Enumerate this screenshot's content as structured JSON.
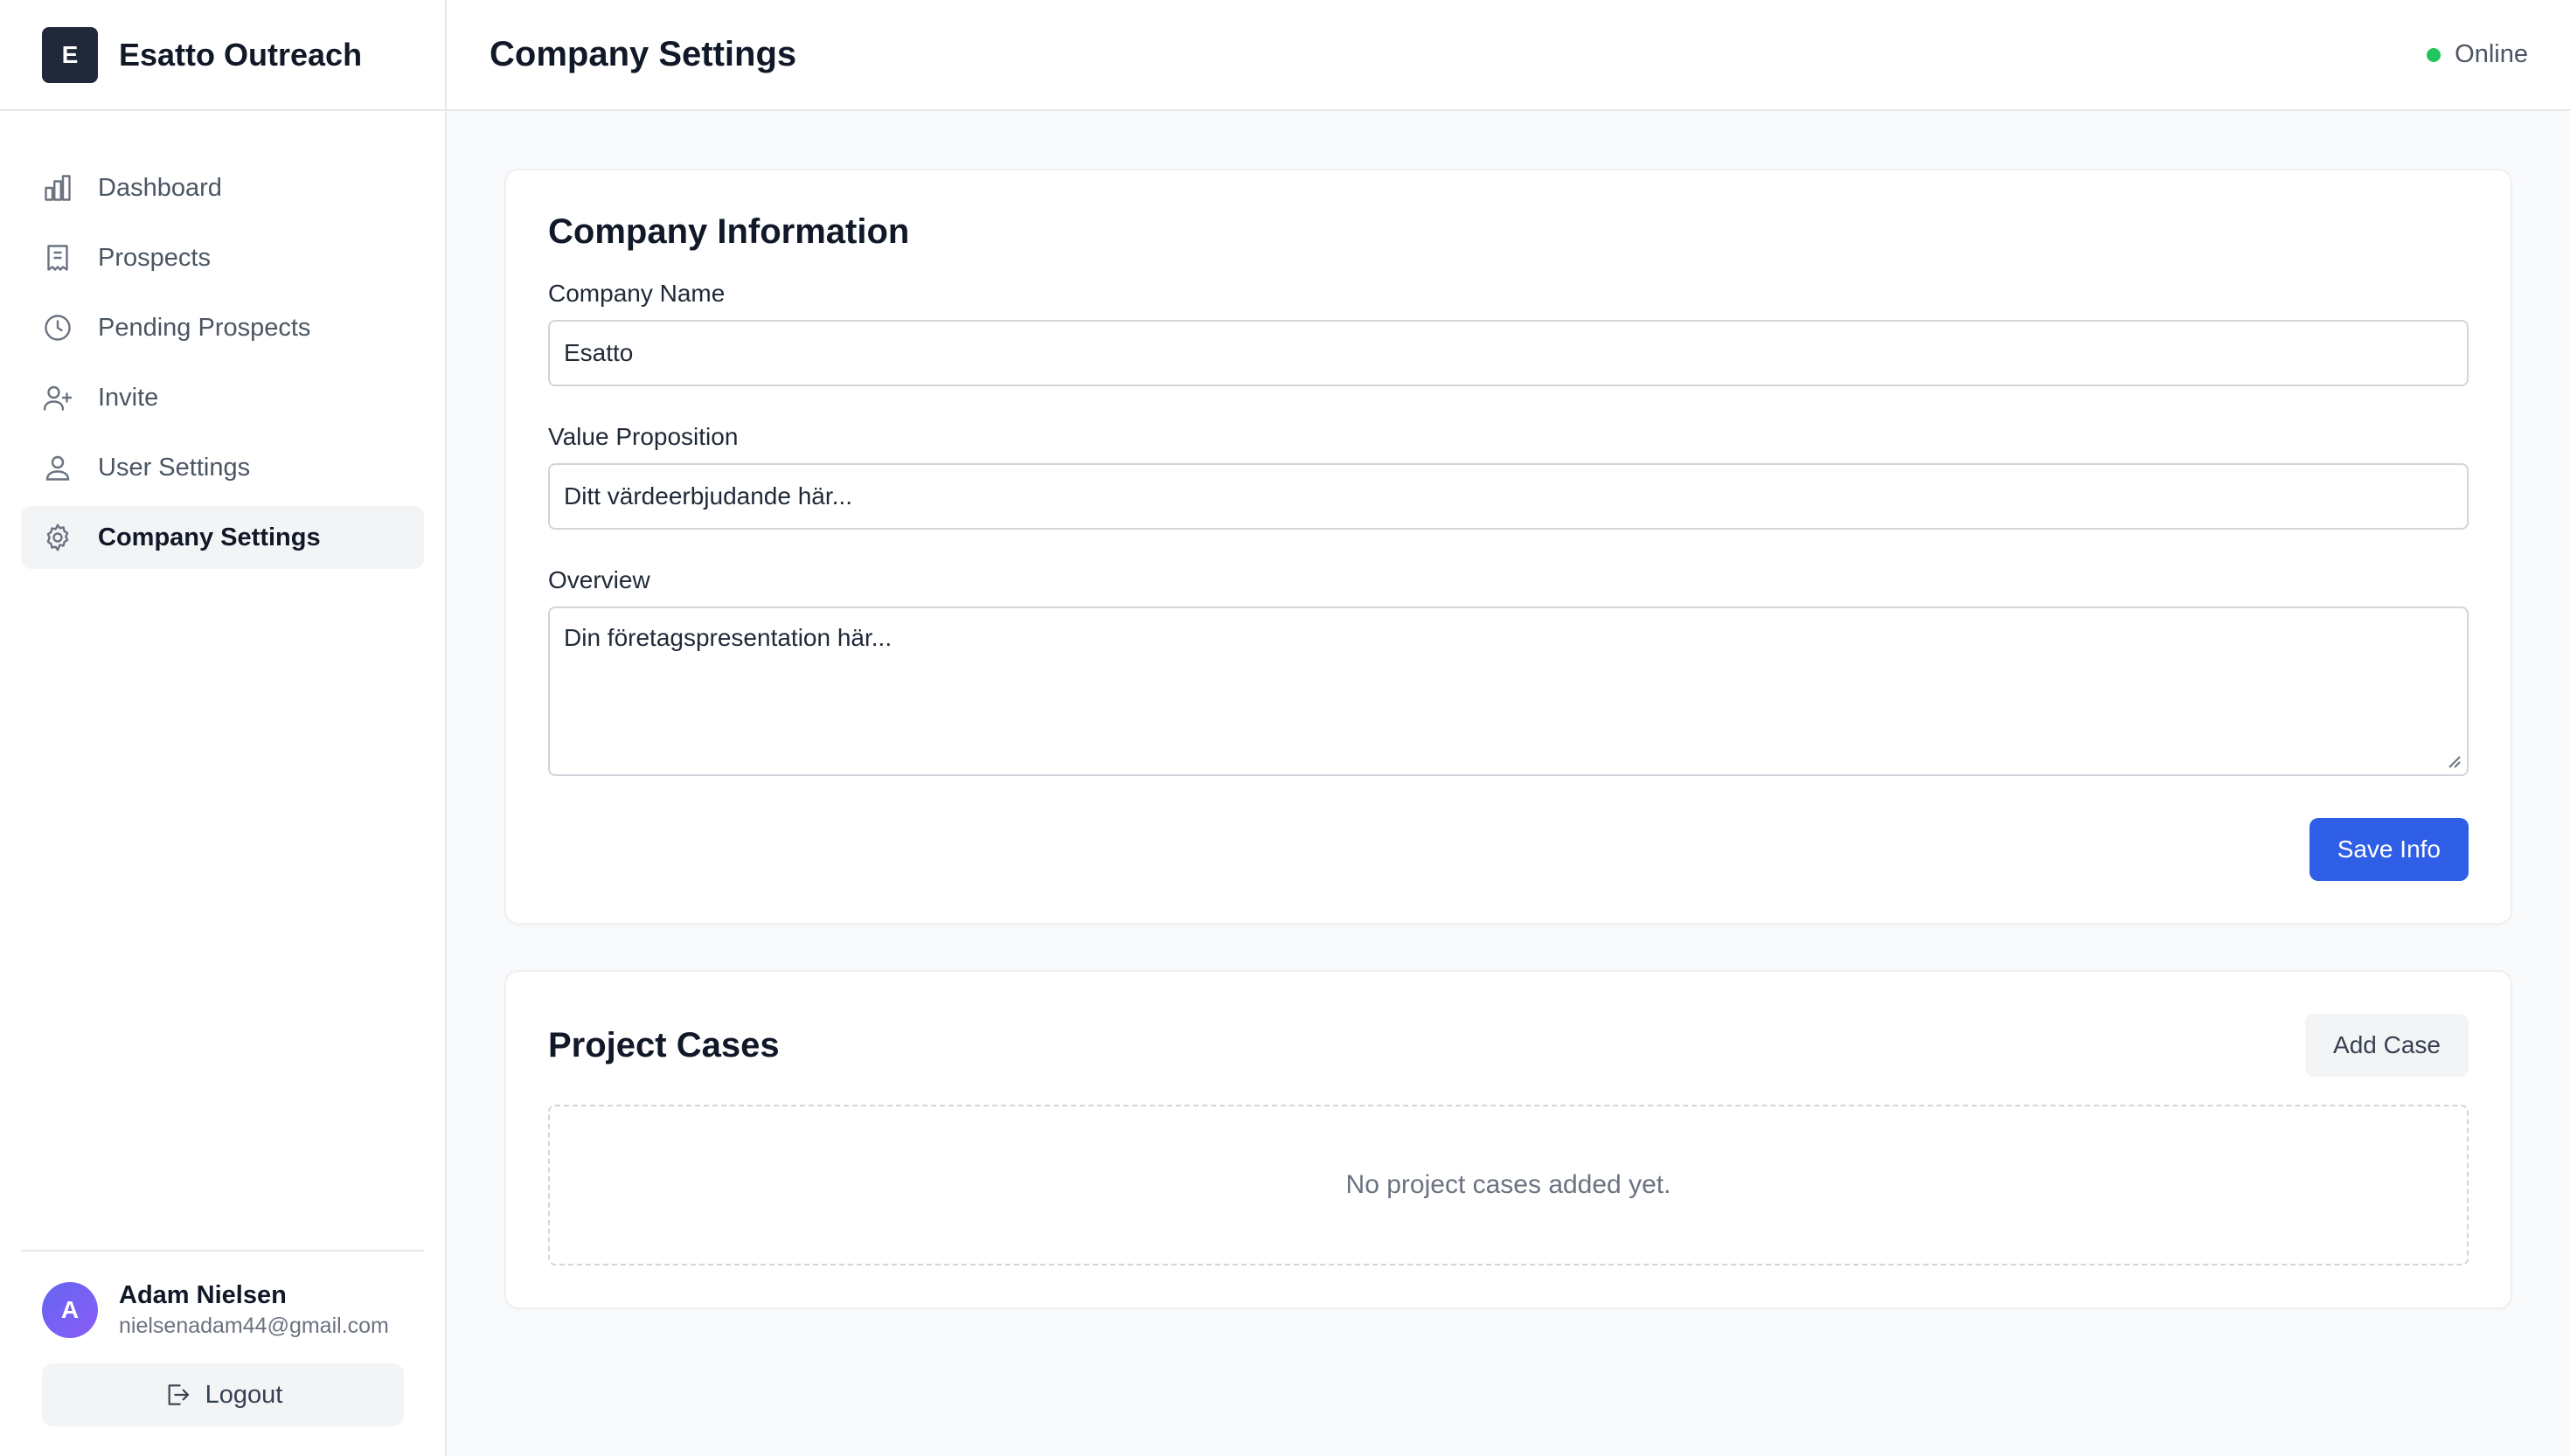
{
  "brand": {
    "logo_letter": "E",
    "name": "Esatto Outreach"
  },
  "sidebar": {
    "items": [
      {
        "label": "Dashboard",
        "icon": "bar-chart-icon"
      },
      {
        "label": "Prospects",
        "icon": "document-icon"
      },
      {
        "label": "Pending Prospects",
        "icon": "clock-icon"
      },
      {
        "label": "Invite",
        "icon": "user-plus-icon"
      },
      {
        "label": "User Settings",
        "icon": "user-icon"
      },
      {
        "label": "Company Settings",
        "icon": "gear-icon",
        "active": true
      }
    ]
  },
  "user": {
    "initial": "A",
    "name": "Adam Nielsen",
    "email": "nielsenadam44@gmail.com",
    "logout_label": "Logout"
  },
  "header": {
    "title": "Company Settings",
    "status_text": "Online",
    "status_color": "#22c55e"
  },
  "company_info": {
    "title": "Company Information",
    "company_name_label": "Company Name",
    "company_name_value": "Esatto",
    "value_prop_label": "Value Proposition",
    "value_prop_placeholder": "Ditt värdeerbjudande här...",
    "overview_label": "Overview",
    "overview_placeholder": "Din företagspresentation här...",
    "save_label": "Save Info"
  },
  "project_cases": {
    "title": "Project Cases",
    "add_label": "Add Case",
    "empty_text": "No project cases added yet."
  },
  "colors": {
    "accent": "#2f5fe6",
    "logo_bg": "#1f2937"
  }
}
